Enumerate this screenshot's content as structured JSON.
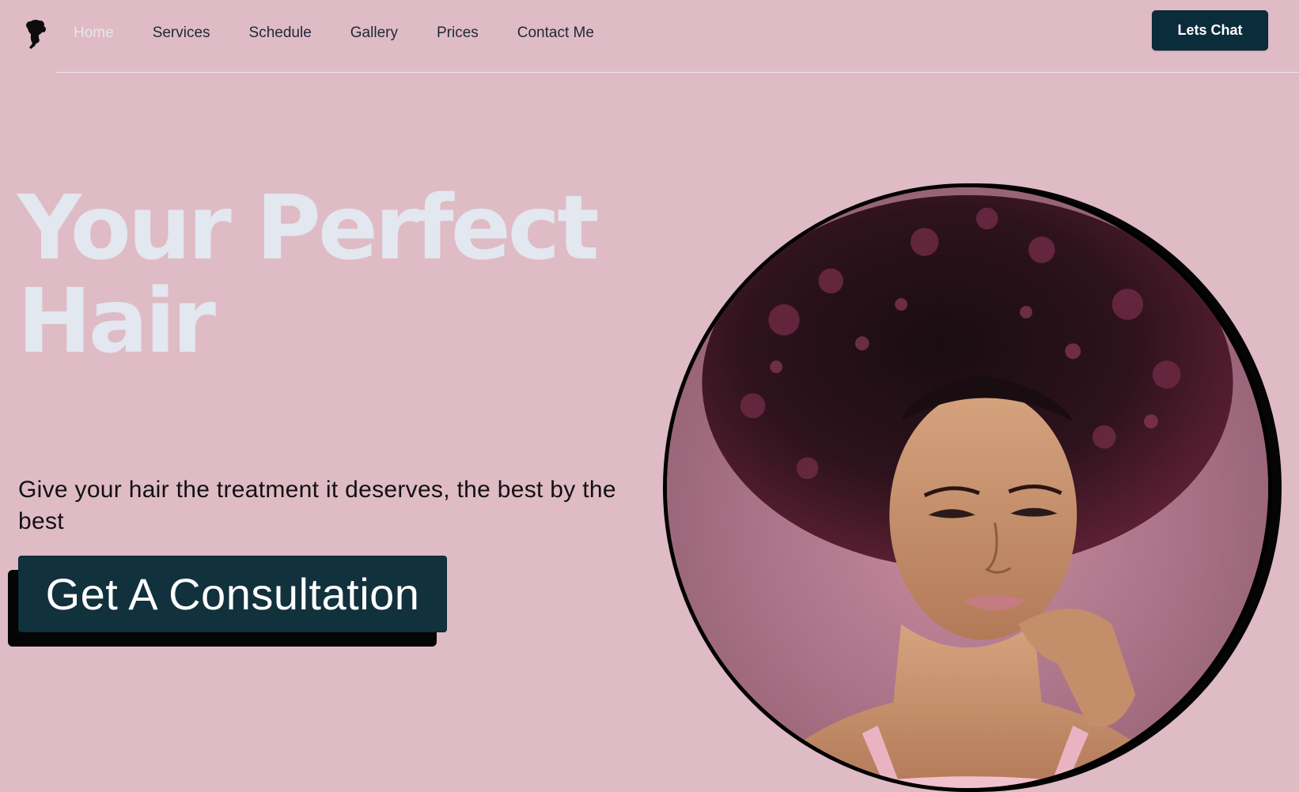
{
  "nav": {
    "links": [
      {
        "label": "Home",
        "active": true
      },
      {
        "label": "Services"
      },
      {
        "label": "Schedule"
      },
      {
        "label": "Gallery"
      },
      {
        "label": "Prices"
      },
      {
        "label": "Contact Me"
      }
    ],
    "cta_label": "Lets Chat",
    "logo_icon": "woman-silhouette-icon"
  },
  "hero": {
    "title_line1": "Your Perfect",
    "title_line2": "Hair",
    "subtitle": "Give your hair the treatment it deserves, the best by the best",
    "cta_label": "Get A Consultation",
    "portrait_icon": "afro-hair-portrait-image"
  },
  "colors": {
    "background": "#dfbbc5",
    "accent": "#0b2c3a",
    "title": "#e3e7ef"
  }
}
